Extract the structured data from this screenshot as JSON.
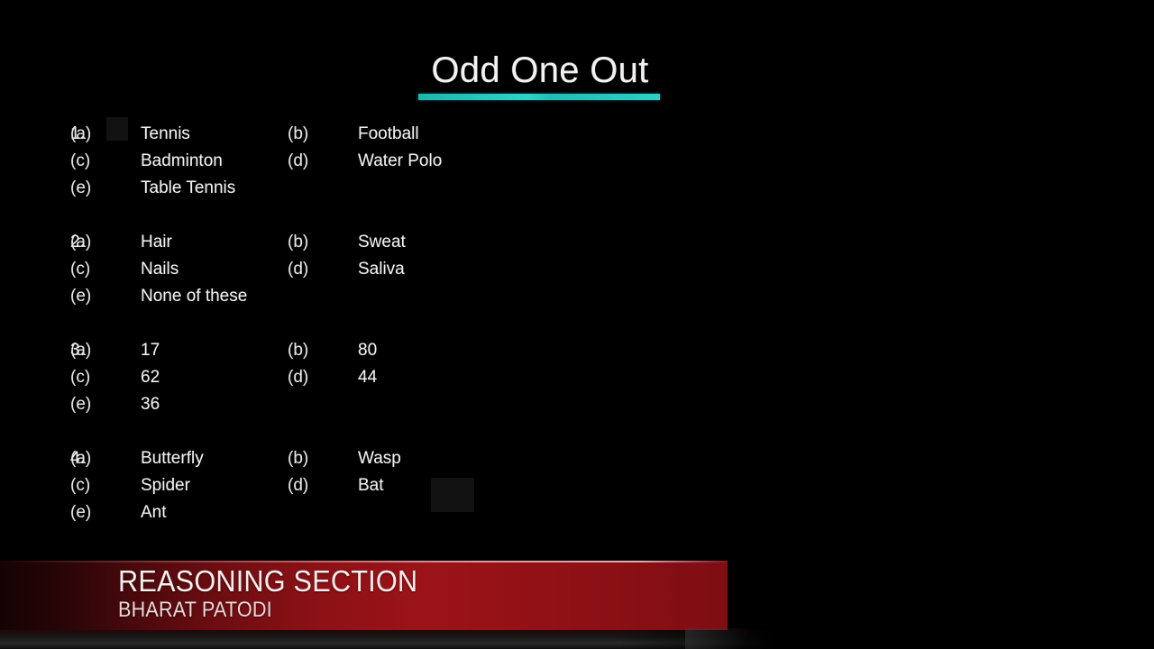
{
  "slide": {
    "title": "Odd One Out",
    "accent_color": "#2ecfc4",
    "background_color": "#000000",
    "text_color": "#f2f2f2"
  },
  "questions": [
    {
      "number": "1.",
      "rows": [
        {
          "label_a": "(a)",
          "option_a": "Tennis",
          "label_b": "(b)",
          "option_b": "Football"
        },
        {
          "label_a": "(c)",
          "option_a": "Badminton",
          "label_b": "(d)",
          "option_b": "Water Polo"
        },
        {
          "label_a": "(e)",
          "option_a": "Table Tennis",
          "label_b": "",
          "option_b": ""
        }
      ]
    },
    {
      "number": "2.",
      "rows": [
        {
          "label_a": "(a)",
          "option_a": "Hair",
          "label_b": "(b)",
          "option_b": "Sweat"
        },
        {
          "label_a": "(c)",
          "option_a": "Nails",
          "label_b": "(d)",
          "option_b": "Saliva"
        },
        {
          "label_a": "(e)",
          "option_a": "None of these",
          "label_b": "",
          "option_b": ""
        }
      ]
    },
    {
      "number": "3.",
      "rows": [
        {
          "label_a": "(a)",
          "option_a": "17",
          "label_b": "(b)",
          "option_b": "80"
        },
        {
          "label_a": "(c)",
          "option_a": "62",
          "label_b": "(d)",
          "option_b": "44"
        },
        {
          "label_a": "(e)",
          "option_a": "36",
          "label_b": "",
          "option_b": ""
        }
      ]
    },
    {
      "number": "4.",
      "rows": [
        {
          "label_a": "(a)",
          "option_a": "Butterfly",
          "label_b": "(b)",
          "option_b": "Wasp"
        },
        {
          "label_a": "(c)",
          "option_a": "Spider",
          "label_b": "(d)",
          "option_b": "Bat"
        },
        {
          "label_a": "(e)",
          "option_a": "Ant",
          "label_b": "",
          "option_b": ""
        }
      ]
    }
  ],
  "banner": {
    "title": "REASONING SECTION",
    "subtitle": "BHARAT PATODI",
    "color": "#8d1116"
  }
}
